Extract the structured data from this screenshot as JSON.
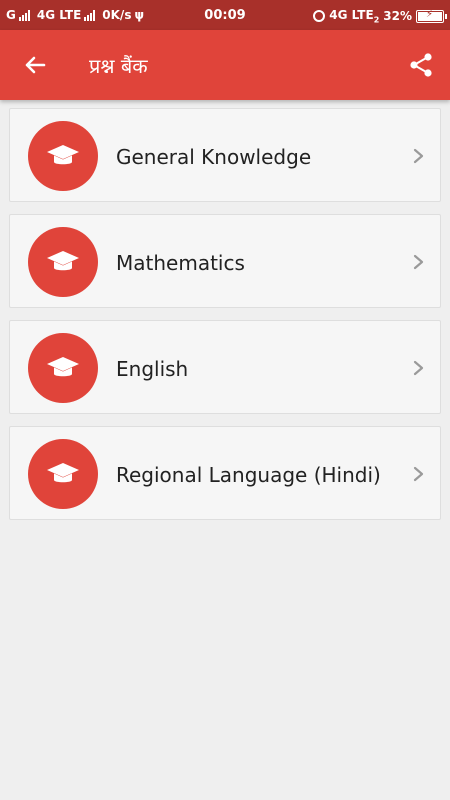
{
  "status_bar": {
    "carrier": "G",
    "network": "4G LTE",
    "data_speed": "0K/s",
    "time": "00:09",
    "network_right": "4G LTE",
    "sim_index": "2",
    "battery": "32%"
  },
  "app_bar": {
    "title": "प्रश्न बैंक",
    "color": "#e0443a"
  },
  "categories": [
    {
      "label": "General Knowledge",
      "icon": "graduation-cap-icon"
    },
    {
      "label": "Mathematics",
      "icon": "graduation-cap-icon"
    },
    {
      "label": "English",
      "icon": "graduation-cap-icon"
    },
    {
      "label": "Regional Language (Hindi)",
      "icon": "graduation-cap-icon"
    }
  ]
}
